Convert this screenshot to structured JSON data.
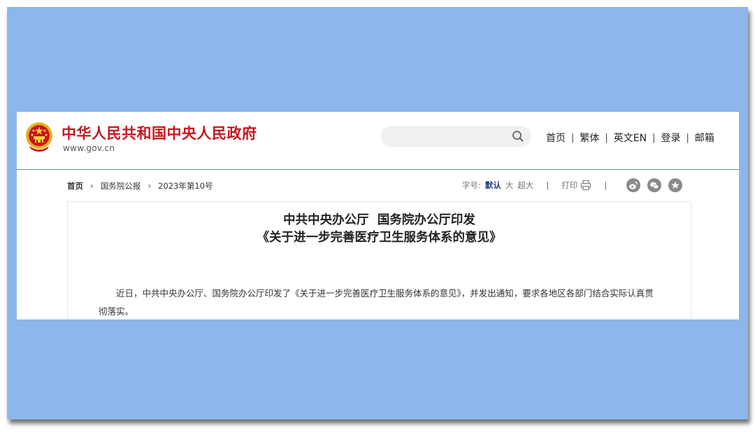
{
  "header": {
    "site_title": "中华人民共和国中央人民政府",
    "site_domain": "www.gov.cn",
    "search_placeholder": "",
    "nav": [
      "首页",
      "繁体",
      "英文EN",
      "登录",
      "邮箱"
    ]
  },
  "breadcrumb": {
    "items": [
      "首页",
      "国务院公报",
      "2023年第10号"
    ]
  },
  "tools": {
    "font_label": "字号:",
    "font_default": "默认",
    "font_large": "大",
    "font_xlarge": "超大",
    "print_label": "打印"
  },
  "share_icons": [
    "weibo-icon",
    "wechat-icon",
    "favorite-icon"
  ],
  "article": {
    "title_line1": "中共中央办公厅  国务院办公厅印发",
    "title_line2": "《关于进一步完善医疗卫生服务体系的意见》",
    "paragraph": "近日，中共中央办公厅、国务院办公厅印发了《关于进一步完善医疗卫生服务体系的意见》，并发出通知，要求各地区各部门结合实际认真贯彻落实。"
  },
  "colors": {
    "brand_red": "#c8161e",
    "frame_blue": "#8db6ec",
    "active_blue": "#1f3e79"
  }
}
